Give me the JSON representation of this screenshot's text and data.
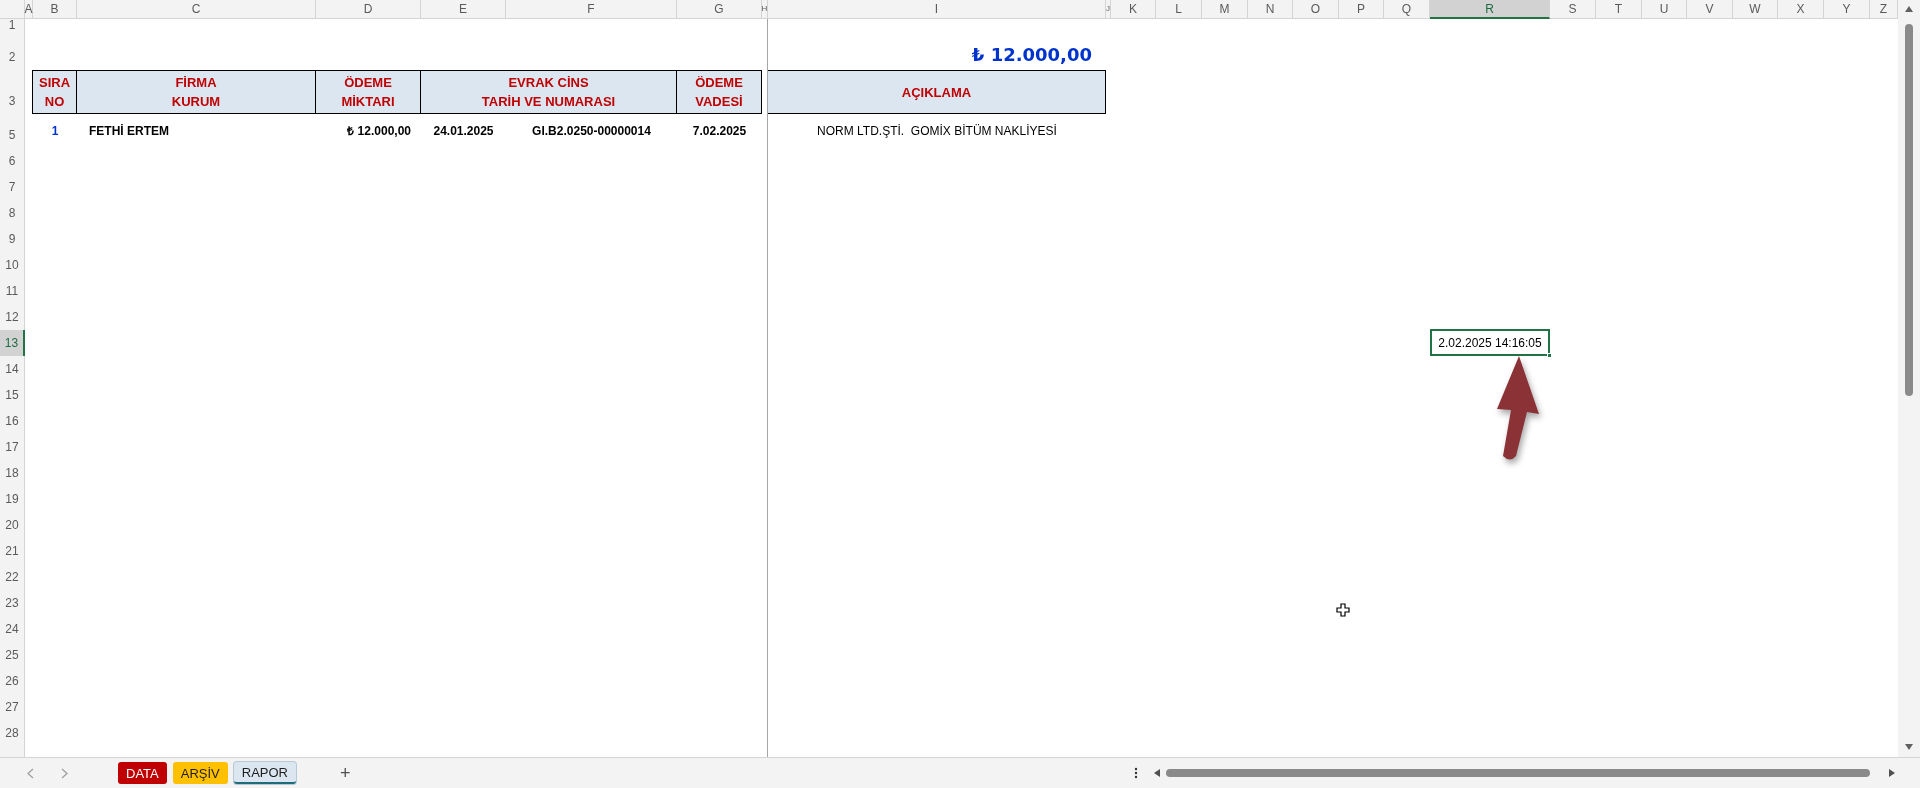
{
  "columns": [
    {
      "label": "A",
      "selected": false
    },
    {
      "label": "B",
      "selected": false
    },
    {
      "label": "C",
      "selected": false
    },
    {
      "label": "D",
      "selected": false
    },
    {
      "label": "E",
      "selected": false
    },
    {
      "label": "F",
      "selected": false
    },
    {
      "label": "G",
      "selected": false
    },
    {
      "label": "H",
      "selected": false
    },
    {
      "label": "I",
      "selected": false
    },
    {
      "label": "J",
      "selected": false
    },
    {
      "label": "K",
      "selected": false
    },
    {
      "label": "L",
      "selected": false
    },
    {
      "label": "M",
      "selected": false
    },
    {
      "label": "N",
      "selected": false
    },
    {
      "label": "O",
      "selected": false
    },
    {
      "label": "P",
      "selected": false
    },
    {
      "label": "Q",
      "selected": false
    },
    {
      "label": "R",
      "selected": true
    },
    {
      "label": "S",
      "selected": false
    },
    {
      "label": "T",
      "selected": false
    },
    {
      "label": "U",
      "selected": false
    },
    {
      "label": "V",
      "selected": false
    },
    {
      "label": "W",
      "selected": false
    },
    {
      "label": "X",
      "selected": false
    },
    {
      "label": "Y",
      "selected": false
    },
    {
      "label": "Z",
      "selected": false
    }
  ],
  "rows": [
    {
      "label": "1",
      "selected": false
    },
    {
      "label": "2",
      "selected": false
    },
    {
      "label": "3",
      "selected": false
    },
    {
      "label": "5",
      "selected": false
    },
    {
      "label": "6",
      "selected": false
    },
    {
      "label": "7",
      "selected": false
    },
    {
      "label": "8",
      "selected": false
    },
    {
      "label": "9",
      "selected": false
    },
    {
      "label": "10",
      "selected": false
    },
    {
      "label": "11",
      "selected": false
    },
    {
      "label": "12",
      "selected": false
    },
    {
      "label": "13",
      "selected": true
    },
    {
      "label": "14",
      "selected": false
    },
    {
      "label": "15",
      "selected": false
    },
    {
      "label": "16",
      "selected": false
    },
    {
      "label": "17",
      "selected": false
    },
    {
      "label": "18",
      "selected": false
    },
    {
      "label": "19",
      "selected": false
    },
    {
      "label": "20",
      "selected": false
    },
    {
      "label": "21",
      "selected": false
    },
    {
      "label": "22",
      "selected": false
    },
    {
      "label": "23",
      "selected": false
    },
    {
      "label": "24",
      "selected": false
    },
    {
      "label": "25",
      "selected": false
    },
    {
      "label": "26",
      "selected": false
    },
    {
      "label": "27",
      "selected": false
    },
    {
      "label": "28",
      "selected": false
    }
  ],
  "total": "₺ 12.000,00",
  "table": {
    "columns": [
      {
        "label": "SIRA\nNO"
      },
      {
        "label": "FİRMA\nKURUM"
      },
      {
        "label": "ÖDEME\nMİKTARI"
      },
      {
        "label": "EVRAK CİNS\nTARİH VE NUMARASI"
      },
      {
        "label": "ÖDEME\nVADESİ"
      },
      {
        "label": "AÇIKLAMA"
      }
    ],
    "rows": [
      {
        "cells": [
          "1",
          "FETHİ ERTEM",
          "₺ 12.000,00",
          {
            "date": "24.01.2025",
            "number": "GI.B2.0250-00000014"
          },
          "7.02.2025",
          "NORM LTD.ŞTİ.  GOMİX BİTÜM NAKLİYESİ"
        ]
      }
    ]
  },
  "selected_cell": {
    "value": "2.02.2025 14:16:05"
  },
  "sheet_tabs": [
    {
      "label": "DATA",
      "color": "#c00000",
      "selected": false
    },
    {
      "label": "ARŞİV",
      "color": "#ffc000",
      "selected": false
    },
    {
      "label": "RAPOR",
      "color": "#dce6f1",
      "selected": true
    }
  ],
  "add_sheet": "+"
}
